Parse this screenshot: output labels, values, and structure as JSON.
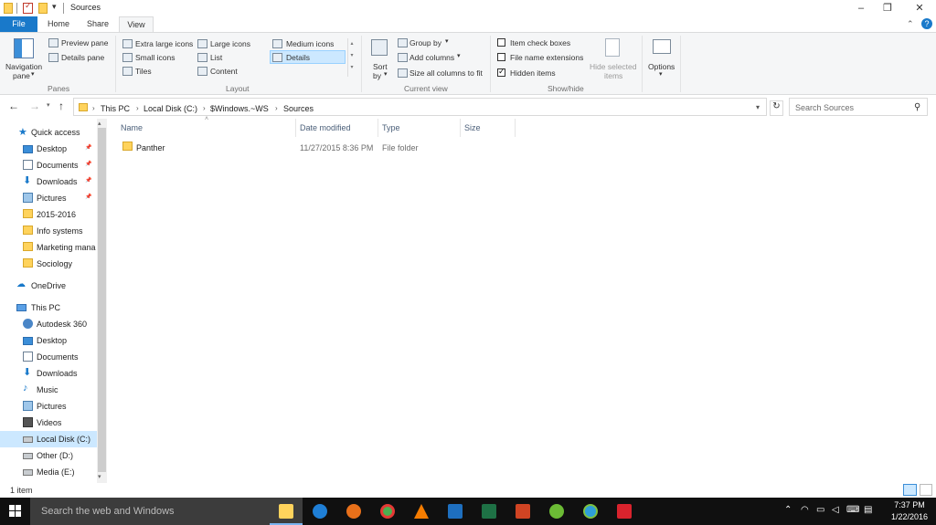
{
  "window": {
    "title": "Sources",
    "minimize": "–",
    "restore": "❐",
    "close": "✕",
    "help": "?"
  },
  "tabs": [
    "File",
    "Home",
    "Share",
    "View"
  ],
  "ribbon": {
    "panes": {
      "navigation_pane": "Navigation",
      "navigation_pane_2": "pane",
      "preview_pane": "Preview pane",
      "details_pane": "Details pane",
      "group_label": "Panes"
    },
    "layout": {
      "extra_large_icons": "Extra large icons",
      "large_icons": "Large icons",
      "medium_icons": "Medium icons",
      "small_icons": "Small icons",
      "list": "List",
      "details": "Details",
      "tiles": "Tiles",
      "content": "Content",
      "group_label": "Layout"
    },
    "current_view": {
      "sort_by": "Sort",
      "sort_by_2": "by",
      "group_by": "Group by",
      "add_columns": "Add columns",
      "size_all_columns": "Size all columns to fit",
      "group_label": "Current view"
    },
    "show_hide": {
      "item_check_boxes": "Item check boxes",
      "file_name_extensions": "File name extensions",
      "hidden_items": "Hidden items",
      "hide_selected": "Hide selected",
      "hide_selected_2": "items",
      "group_label": "Show/hide",
      "item_check_boxes_checked": false,
      "file_name_extensions_checked": false,
      "hidden_items_checked": true
    },
    "options": "Options"
  },
  "address": {
    "crumbs": [
      "This PC",
      "Local Disk (C:)",
      "$Windows.~WS",
      "Sources"
    ],
    "search_placeholder": "Search Sources"
  },
  "nav": {
    "quick_access": "Quick access",
    "quick_items": [
      {
        "label": "Desktop",
        "icon": "desktop-icon",
        "pinned": true
      },
      {
        "label": "Documents",
        "icon": "documents-icon",
        "pinned": true
      },
      {
        "label": "Downloads",
        "icon": "downloads-icon",
        "pinned": true
      },
      {
        "label": "Pictures",
        "icon": "pictures-icon",
        "pinned": true
      },
      {
        "label": "2015-2016",
        "icon": "folder-icon",
        "pinned": false
      },
      {
        "label": "Info systems",
        "icon": "folder-icon",
        "pinned": false
      },
      {
        "label": "Marketing mana",
        "icon": "folder-icon",
        "pinned": false
      },
      {
        "label": "Sociology",
        "icon": "folder-icon",
        "pinned": false
      }
    ],
    "onedrive": "OneDrive",
    "this_pc": "This PC",
    "pc_items": [
      {
        "label": "Autodesk 360",
        "icon": "autodesk-icon"
      },
      {
        "label": "Desktop",
        "icon": "desktop-icon"
      },
      {
        "label": "Documents",
        "icon": "documents-icon"
      },
      {
        "label": "Downloads",
        "icon": "downloads-icon"
      },
      {
        "label": "Music",
        "icon": "music-icon"
      },
      {
        "label": "Pictures",
        "icon": "pictures-icon"
      },
      {
        "label": "Videos",
        "icon": "videos-icon"
      },
      {
        "label": "Local Disk (C:)",
        "icon": "drive-icon"
      },
      {
        "label": "Other (D:)",
        "icon": "drive-icon"
      },
      {
        "label": "Media (E:)",
        "icon": "drive-icon"
      }
    ]
  },
  "files": {
    "columns": [
      "Name",
      "Date modified",
      "Type",
      "Size"
    ],
    "rows": [
      {
        "name": "Panther",
        "date": "11/27/2015 8:36 PM",
        "type": "File folder",
        "size": ""
      }
    ]
  },
  "status": {
    "item_count": "1 item"
  },
  "taskbar": {
    "search_placeholder": "Search the web and Windows",
    "apps": [
      "file-explorer",
      "edge",
      "firefox",
      "chrome",
      "vlc",
      "outlook",
      "excel",
      "powerpoint",
      "utorrent",
      "webcam",
      "acrobat"
    ],
    "time": "7:37 PM",
    "date": "1/22/2016"
  },
  "colors": {
    "file_tab": "#1979ca",
    "selected_nav": "#cce8ff",
    "taskbar": "#101010",
    "folder": "#ffd35c"
  }
}
